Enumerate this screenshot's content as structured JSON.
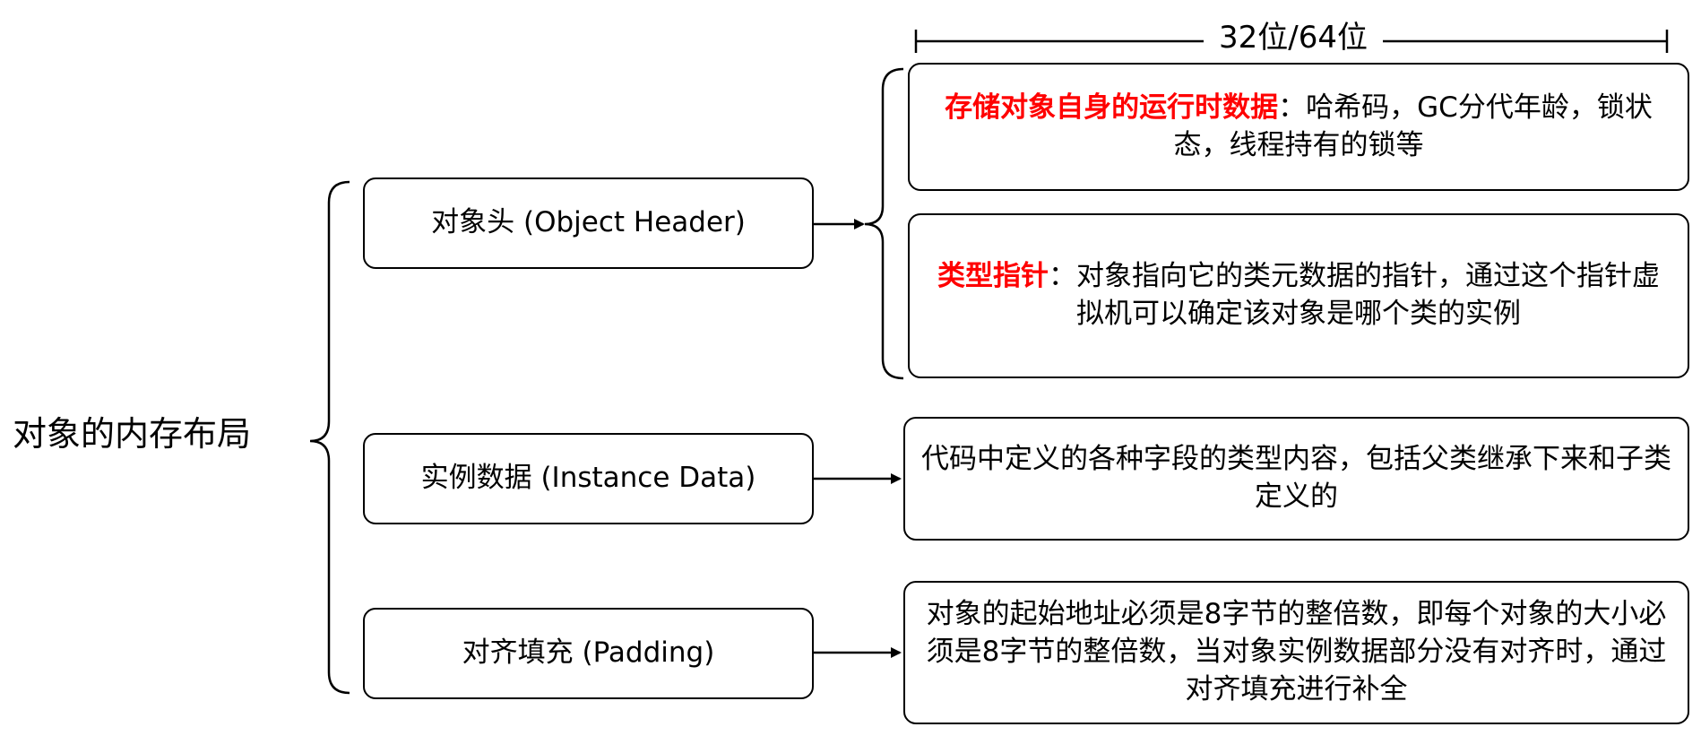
{
  "root": {
    "label": "对象的内存布局"
  },
  "width_indicator": {
    "label": "32位/64位"
  },
  "components": {
    "object_header": {
      "label": "对象头 (Object Header)",
      "mark_word": {
        "highlight": "存储对象自身的运行时数据",
        "text": "：哈希码，GC分代年龄，锁状态，线程持有的锁等"
      },
      "klass_pointer": {
        "highlight": "类型指针",
        "text": "：对象指向它的类元数据的指针，通过这个指针虚拟机可以确定该对象是哪个类的实例"
      }
    },
    "instance_data": {
      "label": "实例数据 (Instance Data)",
      "description": "代码中定义的各种字段的类型内容，包括父类继承下来和子类定义的"
    },
    "padding": {
      "label": "对齐填充 (Padding)",
      "description": "对象的起始地址必须是8字节的整倍数，即每个对象的大小必须是8字节的整倍数，当对象实例数据部分没有对齐时，通过对齐填充进行补全"
    }
  },
  "colors": {
    "highlight": "#ff0000",
    "line": "#000000",
    "background": "#ffffff"
  }
}
